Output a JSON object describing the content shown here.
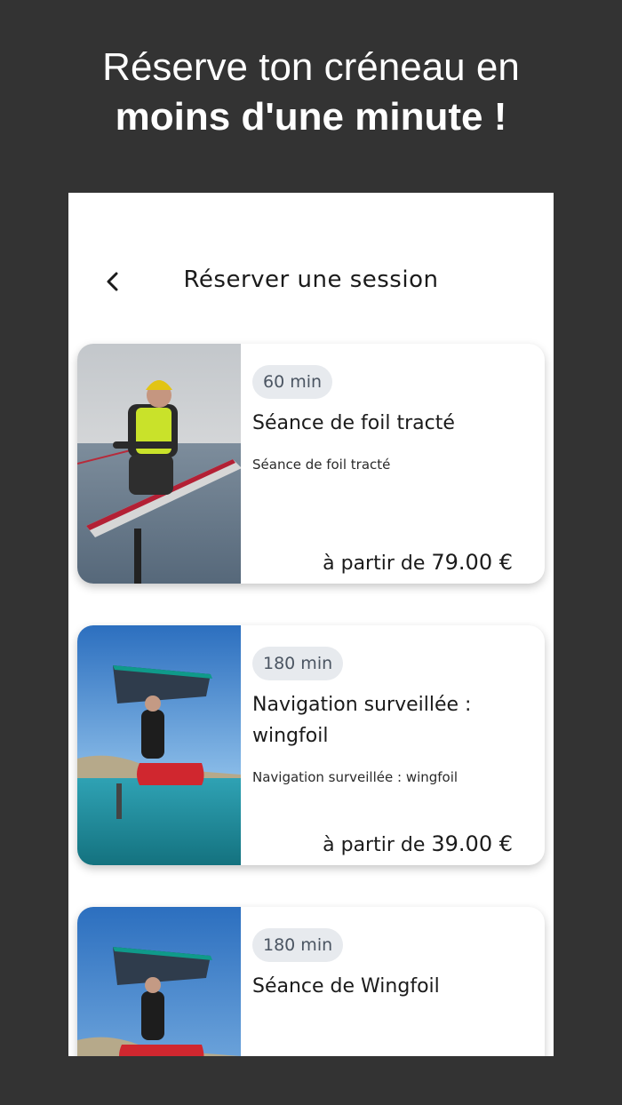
{
  "headline": {
    "line1": "Réserve ton créneau en",
    "line2": "moins d'une minute !"
  },
  "appbar": {
    "back_icon": "chevron-left-icon",
    "title": "Réserver une session"
  },
  "sessions": [
    {
      "duration": "60 min",
      "title": "Séance de foil tracté",
      "description": "Séance de foil tracté",
      "price_prefix": "à partir de",
      "price": "79.00 €"
    },
    {
      "duration": "180 min",
      "title": "Navigation surveillée : wingfoil",
      "description": "Navigation surveillée : wingfoil",
      "price_prefix": "à partir de",
      "price": "39.00 €"
    },
    {
      "duration": "180 min",
      "title": "Séance de Wingfoil"
    }
  ]
}
